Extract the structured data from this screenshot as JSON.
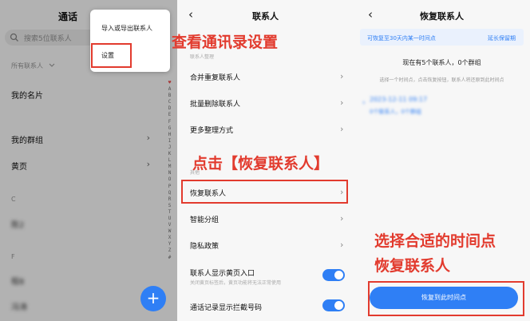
{
  "panel1": {
    "title": "通话",
    "search_placeholder": "搜索5位联系人",
    "all_contacts": "所有联系人",
    "rows": [
      "我的名片",
      "我的群组",
      "黄页"
    ],
    "section_c": "C",
    "section_f": "F",
    "blurred": [
      "陈2",
      "程8",
      "冯涛"
    ],
    "menu_import": "导入或导出联系人",
    "menu_settings": "设置",
    "index_chars": [
      "♥",
      "A",
      "B",
      "C",
      "D",
      "E",
      "F",
      "G",
      "H",
      "I",
      "J",
      "K",
      "L",
      "M",
      "N",
      "O",
      "P",
      "Q",
      "R",
      "S",
      "T",
      "U",
      "V",
      "W",
      "X",
      "Y",
      "Z",
      "#"
    ],
    "fab": "+"
  },
  "panel2": {
    "title": "联系人",
    "section_manage": "联系人整理",
    "rows": [
      "合并重复联系人",
      "批量删除联系人",
      "更多整理方式"
    ],
    "section_other": "其他",
    "rows2": [
      "恢复联系人",
      "智能分组",
      "隐私政策"
    ],
    "toggle1_label": "联系人显示黄页入口",
    "toggle1_sub": "关闭黄页标签后，黄页功能将无法正常使用",
    "toggle2_label": "通话记录显示拦截号码"
  },
  "panel3": {
    "title": "恢复联系人",
    "banner_text": "可恢复至30天内某一时间点",
    "banner_link": "延长保留期",
    "summary": "现在有5个联系人，0个群组",
    "hint": "选择一个时间点，点击恢复按钮，联系人将还原到此时间点",
    "timepoint_date": "2023-12-11 09:17",
    "timepoint_detail": "0个联系人，0个群组",
    "restore_button": "恢复到此时间点"
  },
  "annotations": {
    "view_settings": "查看通讯录设置",
    "click_restore": "点击【恢复联系人】",
    "choose_line1": "选择合适的时间点",
    "choose_line2": "恢复联系人"
  },
  "colors": {
    "accent": "#2f7ff5",
    "highlight": "#e23b2e"
  },
  "icons": {
    "back": "chevron-left-icon",
    "chevron": "chevron-right-icon",
    "search": "search-icon",
    "add": "plus-icon"
  }
}
